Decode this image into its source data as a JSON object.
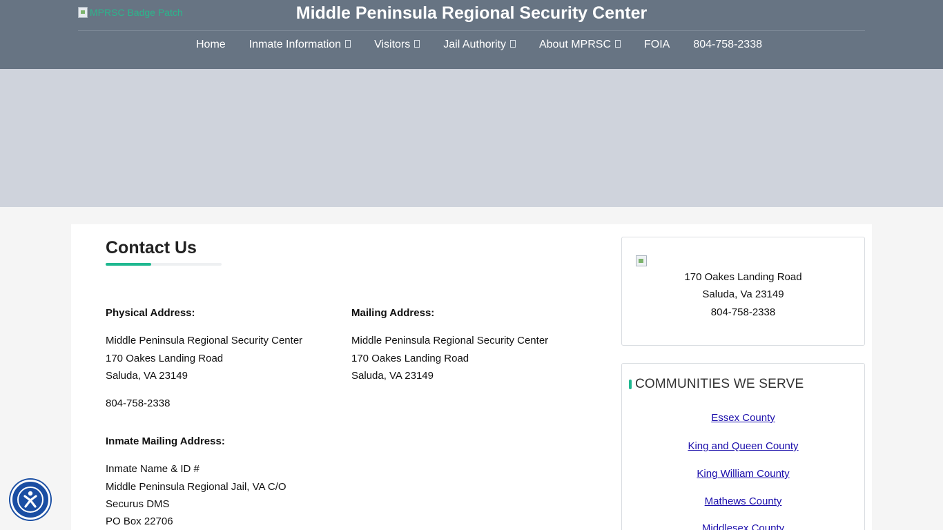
{
  "header": {
    "logo_alt": "MPRSC Badge Patch",
    "title": "Middle Peninsula Regional Security Center"
  },
  "nav": {
    "items": [
      {
        "label": "Home"
      },
      {
        "label": "Inmate Information"
      },
      {
        "label": "Visitors"
      },
      {
        "label": "Jail Authority"
      },
      {
        "label": "About MPRSC"
      },
      {
        "label": "FOIA"
      },
      {
        "label": "804-758-2338"
      }
    ]
  },
  "main": {
    "title": "Contact Us",
    "physical": {
      "label": "Physical Address:",
      "lines": [
        "Middle Peninsula Regional Security Center",
        "170 Oakes Landing Road",
        "Saluda, VA 23149"
      ],
      "phone": "804-758-2338"
    },
    "mailing": {
      "label": "Mailing Address:",
      "lines": [
        "Middle Peninsula Regional Security Center",
        "170 Oakes Landing Road",
        "Saluda, VA 23149"
      ]
    },
    "inmate_mailing": {
      "label": "Inmate Mailing Address:",
      "lines": [
        "Inmate Name & ID #",
        "Middle Peninsula Regional Jail, VA C/O",
        "Securus DMS",
        "PO Box 22706"
      ]
    }
  },
  "sidebar": {
    "address_card": {
      "lines": [
        "170 Oakes Landing Road",
        "Saluda, Va 23149",
        "804-758-2338"
      ]
    },
    "communities": {
      "title": "COMMUNITIES WE SERVE",
      "links": [
        "Essex County",
        "King and Queen County",
        "King William County",
        "Mathews County",
        "Middlesex County"
      ]
    }
  },
  "colors": {
    "header_bg": "#677483",
    "hero_bg": "#cfd3dc",
    "accent": "#1fb890",
    "link": "#1a0dab",
    "a11y_button": "#1a4ea3"
  },
  "icons": {
    "a11y": "accessibility-icon",
    "dropdown": "chevron-down-icon",
    "broken_image": "broken-image-icon"
  }
}
